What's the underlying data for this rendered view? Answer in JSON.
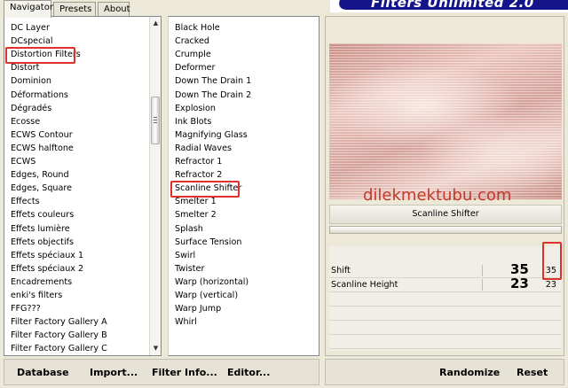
{
  "tabs": [
    "Navigator",
    "Presets",
    "About"
  ],
  "banner_title": "Filters Unlimited 2.0",
  "categories": [
    "DC Layer",
    "DCspecial",
    "Distortion Filters",
    "Distort",
    "Dominion",
    "Déformations",
    "Dégradés",
    "Ecosse",
    "ECWS Contour",
    "ECWS halftone",
    "ECWS",
    "Edges, Round",
    "Edges, Square",
    "Effects",
    "Effets couleurs",
    "Effets lumière",
    "Effets objectifs",
    "Effets spéciaux 1",
    "Effets spéciaux 2",
    "Encadrements",
    "enki's filters",
    "FFG???",
    "Filter Factory Gallery A",
    "Filter Factory Gallery B",
    "Filter Factory Gallery C"
  ],
  "selected_category": "Distortion Filters",
  "filters": [
    "Black Hole",
    "Cracked",
    "Crumple",
    "Deformer",
    "Down The Drain 1",
    "Down The Drain 2",
    "Explosion",
    "Ink Blots",
    "Magnifying Glass",
    "Radial Waves",
    "Refractor 1",
    "Refractor 2",
    "Scanline Shifter",
    "Smelter 1",
    "Smelter 2",
    "Splash",
    "Surface Tension",
    "Swirl",
    "Twister",
    "Warp (horizontal)",
    "Warp (vertical)",
    "Warp Jump",
    "Whirl"
  ],
  "selected_filter": "Scanline Shifter",
  "preview": {
    "watermark": "dilekmektubu.com",
    "colors": [
      "#c98e85",
      "#e9c3ba",
      "#edd0c8"
    ]
  },
  "filter_title": "Scanline Shifter",
  "params": [
    {
      "label": "Shift",
      "big": "35",
      "value": "35"
    },
    {
      "label": "Scanline Height",
      "big": "23",
      "value": "23"
    }
  ],
  "buttons": {
    "database": "Database",
    "import": "Import...",
    "filter_info": "Filter Info...",
    "editor": "Editor...",
    "randomize": "Randomize",
    "reset": "Reset"
  },
  "accent_color": "#e0302a"
}
